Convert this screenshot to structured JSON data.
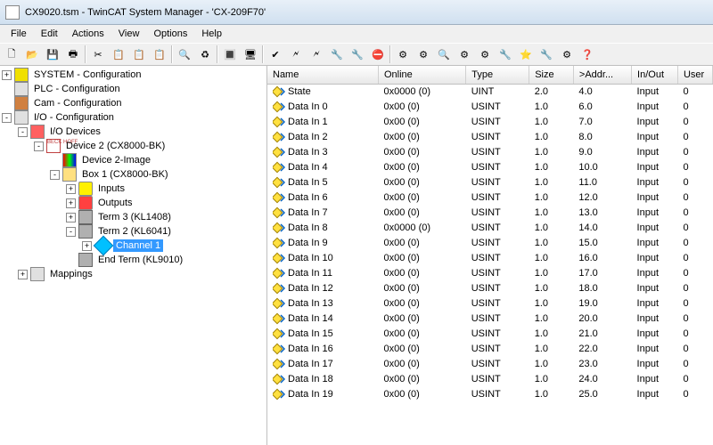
{
  "window": {
    "title": "CX9020.tsm - TwinCAT System Manager - 'CX-209F70'"
  },
  "menu": [
    "File",
    "Edit",
    "Actions",
    "View",
    "Options",
    "Help"
  ],
  "tree": [
    {
      "level": 0,
      "exp": "+",
      "icon": "ic-sys",
      "label": "SYSTEM - Configuration"
    },
    {
      "level": 0,
      "exp": "",
      "icon": "ic-plc",
      "label": "PLC - Configuration"
    },
    {
      "level": 0,
      "exp": "",
      "icon": "ic-cam",
      "label": "Cam - Configuration"
    },
    {
      "level": 0,
      "exp": "-",
      "icon": "ic-io",
      "label": "I/O - Configuration"
    },
    {
      "level": 1,
      "exp": "-",
      "icon": "ic-devs",
      "label": "I/O Devices"
    },
    {
      "level": 2,
      "exp": "-",
      "icon": "ic-dev",
      "label": "Device 2 (CX8000-BK)"
    },
    {
      "level": 3,
      "exp": "",
      "icon": "ic-img",
      "label": "Device 2-Image"
    },
    {
      "level": 3,
      "exp": "-",
      "icon": "ic-box",
      "label": "Box 1 (CX8000-BK)"
    },
    {
      "level": 4,
      "exp": "+",
      "icon": "ic-in",
      "label": "Inputs"
    },
    {
      "level": 4,
      "exp": "+",
      "icon": "ic-out",
      "label": "Outputs"
    },
    {
      "level": 4,
      "exp": "+",
      "icon": "ic-term",
      "label": "Term 3 (KL1408)"
    },
    {
      "level": 4,
      "exp": "-",
      "icon": "ic-term",
      "label": "Term 2 (KL6041)"
    },
    {
      "level": 5,
      "exp": "+",
      "icon": "ic-chan",
      "label": "Channel 1",
      "selected": true
    },
    {
      "level": 4,
      "exp": "",
      "icon": "ic-term",
      "label": "End Term (KL9010)"
    },
    {
      "level": 1,
      "exp": "+",
      "icon": "ic-map",
      "label": "Mappings"
    }
  ],
  "columns": [
    "Name",
    "Online",
    "Type",
    "Size",
    ">Addr...",
    "In/Out",
    "User"
  ],
  "rows": [
    {
      "name": "State",
      "online": "0x0000 (0)",
      "type": "UINT",
      "size": "2.0",
      "addr": "4.0",
      "inout": "Input",
      "user": "0"
    },
    {
      "name": "Data In 0",
      "online": "0x00 (0)",
      "type": "USINT",
      "size": "1.0",
      "addr": "6.0",
      "inout": "Input",
      "user": "0"
    },
    {
      "name": "Data In 1",
      "online": "0x00 (0)",
      "type": "USINT",
      "size": "1.0",
      "addr": "7.0",
      "inout": "Input",
      "user": "0"
    },
    {
      "name": "Data In 2",
      "online": "0x00 (0)",
      "type": "USINT",
      "size": "1.0",
      "addr": "8.0",
      "inout": "Input",
      "user": "0"
    },
    {
      "name": "Data In 3",
      "online": "0x00 (0)",
      "type": "USINT",
      "size": "1.0",
      "addr": "9.0",
      "inout": "Input",
      "user": "0"
    },
    {
      "name": "Data In 4",
      "online": "0x00 (0)",
      "type": "USINT",
      "size": "1.0",
      "addr": "10.0",
      "inout": "Input",
      "user": "0"
    },
    {
      "name": "Data In 5",
      "online": "0x00 (0)",
      "type": "USINT",
      "size": "1.0",
      "addr": "11.0",
      "inout": "Input",
      "user": "0"
    },
    {
      "name": "Data In 6",
      "online": "0x00 (0)",
      "type": "USINT",
      "size": "1.0",
      "addr": "12.0",
      "inout": "Input",
      "user": "0"
    },
    {
      "name": "Data In 7",
      "online": "0x00 (0)",
      "type": "USINT",
      "size": "1.0",
      "addr": "13.0",
      "inout": "Input",
      "user": "0"
    },
    {
      "name": "Data In 8",
      "online": "0x0000 (0)",
      "type": "USINT",
      "size": "1.0",
      "addr": "14.0",
      "inout": "Input",
      "user": "0"
    },
    {
      "name": "Data In 9",
      "online": "0x00 (0)",
      "type": "USINT",
      "size": "1.0",
      "addr": "15.0",
      "inout": "Input",
      "user": "0"
    },
    {
      "name": "Data In 10",
      "online": "0x00 (0)",
      "type": "USINT",
      "size": "1.0",
      "addr": "16.0",
      "inout": "Input",
      "user": "0"
    },
    {
      "name": "Data In 11",
      "online": "0x00 (0)",
      "type": "USINT",
      "size": "1.0",
      "addr": "17.0",
      "inout": "Input",
      "user": "0"
    },
    {
      "name": "Data In 12",
      "online": "0x00 (0)",
      "type": "USINT",
      "size": "1.0",
      "addr": "18.0",
      "inout": "Input",
      "user": "0"
    },
    {
      "name": "Data In 13",
      "online": "0x00 (0)",
      "type": "USINT",
      "size": "1.0",
      "addr": "19.0",
      "inout": "Input",
      "user": "0"
    },
    {
      "name": "Data In 14",
      "online": "0x00 (0)",
      "type": "USINT",
      "size": "1.0",
      "addr": "20.0",
      "inout": "Input",
      "user": "0"
    },
    {
      "name": "Data In 15",
      "online": "0x00 (0)",
      "type": "USINT",
      "size": "1.0",
      "addr": "21.0",
      "inout": "Input",
      "user": "0"
    },
    {
      "name": "Data In 16",
      "online": "0x00 (0)",
      "type": "USINT",
      "size": "1.0",
      "addr": "22.0",
      "inout": "Input",
      "user": "0"
    },
    {
      "name": "Data In 17",
      "online": "0x00 (0)",
      "type": "USINT",
      "size": "1.0",
      "addr": "23.0",
      "inout": "Input",
      "user": "0"
    },
    {
      "name": "Data In 18",
      "online": "0x00 (0)",
      "type": "USINT",
      "size": "1.0",
      "addr": "24.0",
      "inout": "Input",
      "user": "0"
    },
    {
      "name": "Data In 19",
      "online": "0x00 (0)",
      "type": "USINT",
      "size": "1.0",
      "addr": "25.0",
      "inout": "Input",
      "user": "0"
    }
  ],
  "toolbar_glyphs": [
    "🗋",
    "📂",
    "💾",
    "🖶",
    "|",
    "✂",
    "📋",
    "📋",
    "📋",
    "|",
    "🔍",
    "♻",
    "|",
    "🔳",
    "🖥",
    "|",
    "✔",
    "🗲",
    "🗲",
    "🔧",
    "🔧",
    "⛔",
    "|",
    "⚙",
    "⚙",
    "🔍",
    "⚙",
    "⚙",
    "🔧",
    "⭐",
    "🔧",
    "⚙",
    "❓"
  ]
}
